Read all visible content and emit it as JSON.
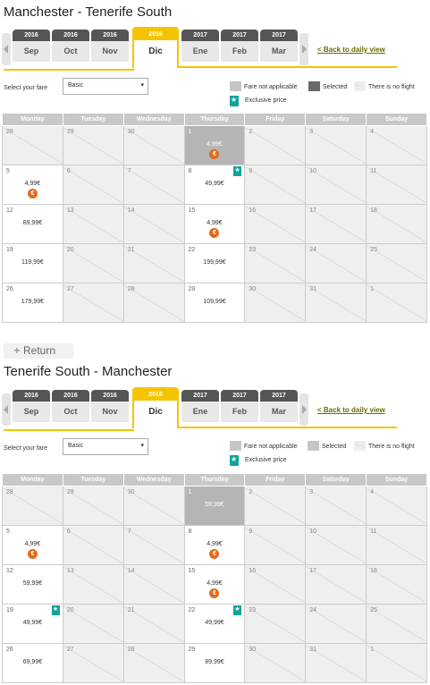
{
  "outbound": {
    "title": "Manchester - Tenerife South",
    "tabs": [
      {
        "year": "2016",
        "month": "Sep",
        "selected": false
      },
      {
        "year": "2016",
        "month": "Oct",
        "selected": false
      },
      {
        "year": "2016",
        "month": "Nov",
        "selected": false
      },
      {
        "year": "2016",
        "month": "Dic",
        "selected": true
      },
      {
        "year": "2017",
        "month": "Ene",
        "selected": false
      },
      {
        "year": "2017",
        "month": "Feb",
        "selected": false
      },
      {
        "year": "2017",
        "month": "Mar",
        "selected": false
      }
    ],
    "back_label": "< Back to daily view",
    "fare_label": "Select your fare",
    "fare_value": "Basic",
    "legend": {
      "not_applicable": "Fare not applicable",
      "selected": "Selected",
      "no_flight": "There is no flight",
      "exclusive": "Exclusive price"
    },
    "weekdays": [
      "Monday",
      "Tuesday",
      "Wednesday",
      "Thursday",
      "Friday",
      "Saturday",
      "Sunday"
    ],
    "weeks": [
      [
        {
          "d": "28",
          "s": "nf"
        },
        {
          "d": "29",
          "s": "nf"
        },
        {
          "d": "30",
          "s": "nf"
        },
        {
          "d": "1",
          "s": "sd",
          "p": "4,99€",
          "coin": true
        },
        {
          "d": "2",
          "s": "nf"
        },
        {
          "d": "3",
          "s": "nf"
        },
        {
          "d": "4",
          "s": "nf"
        }
      ],
      [
        {
          "d": "5",
          "s": "av",
          "p": "4,99€",
          "coin": true
        },
        {
          "d": "6",
          "s": "nf"
        },
        {
          "d": "7",
          "s": "nf"
        },
        {
          "d": "8",
          "s": "av",
          "p": "49,99€",
          "bm": true
        },
        {
          "d": "9",
          "s": "nf"
        },
        {
          "d": "10",
          "s": "nf"
        },
        {
          "d": "11",
          "s": "nf"
        }
      ],
      [
        {
          "d": "12",
          "s": "av",
          "p": "89,99€"
        },
        {
          "d": "13",
          "s": "nf"
        },
        {
          "d": "14",
          "s": "nf"
        },
        {
          "d": "15",
          "s": "av",
          "p": "4,99€",
          "coin": true
        },
        {
          "d": "16",
          "s": "nf"
        },
        {
          "d": "17",
          "s": "nf"
        },
        {
          "d": "18",
          "s": "nf"
        }
      ],
      [
        {
          "d": "19",
          "s": "av",
          "p": "119,99€"
        },
        {
          "d": "20",
          "s": "nf"
        },
        {
          "d": "21",
          "s": "nf"
        },
        {
          "d": "22",
          "s": "av",
          "p": "199,99€"
        },
        {
          "d": "23",
          "s": "nf"
        },
        {
          "d": "24",
          "s": "nf"
        },
        {
          "d": "25",
          "s": "nf"
        }
      ],
      [
        {
          "d": "26",
          "s": "av",
          "p": "179,99€"
        },
        {
          "d": "27",
          "s": "nf"
        },
        {
          "d": "28",
          "s": "nf"
        },
        {
          "d": "29",
          "s": "av",
          "p": "109,99€"
        },
        {
          "d": "30",
          "s": "nf"
        },
        {
          "d": "31",
          "s": "nf"
        },
        {
          "d": "1",
          "s": "nf"
        }
      ]
    ]
  },
  "return_button": {
    "label": "Return"
  },
  "inbound": {
    "title": "Tenerife South - Manchester",
    "tabs": [
      {
        "year": "2016",
        "month": "Sep",
        "selected": false
      },
      {
        "year": "2016",
        "month": "Oct",
        "selected": false
      },
      {
        "year": "2016",
        "month": "Nov",
        "selected": false
      },
      {
        "year": "2016",
        "month": "Dic",
        "selected": true
      },
      {
        "year": "2017",
        "month": "Ene",
        "selected": false
      },
      {
        "year": "2017",
        "month": "Feb",
        "selected": false
      },
      {
        "year": "2017",
        "month": "Mar",
        "selected": false
      }
    ],
    "back_label": "< Back to daily view",
    "fare_label": "Select your fare",
    "fare_value": "Basic",
    "legend": {
      "not_applicable": "Fare not applicable",
      "selected": "Selected",
      "no_flight": "There is no flight",
      "exclusive": "Exclusive price"
    },
    "weekdays": [
      "Monday",
      "Tuesday",
      "Wednesday",
      "Thursday",
      "Friday",
      "Saturday",
      "Sunday"
    ],
    "weeks": [
      [
        {
          "d": "28",
          "s": "nf"
        },
        {
          "d": "29",
          "s": "nf"
        },
        {
          "d": "30",
          "s": "nf"
        },
        {
          "d": "1",
          "s": "sd",
          "p": "59,99€"
        },
        {
          "d": "2",
          "s": "nf"
        },
        {
          "d": "3",
          "s": "nf"
        },
        {
          "d": "4",
          "s": "nf"
        }
      ],
      [
        {
          "d": "5",
          "s": "av",
          "p": "4,99€",
          "coin": true
        },
        {
          "d": "6",
          "s": "nf"
        },
        {
          "d": "7",
          "s": "nf"
        },
        {
          "d": "8",
          "s": "av",
          "p": "4,99€",
          "coin": true
        },
        {
          "d": "9",
          "s": "nf"
        },
        {
          "d": "10",
          "s": "nf"
        },
        {
          "d": "11",
          "s": "nf"
        }
      ],
      [
        {
          "d": "12",
          "s": "av",
          "p": "59,99€"
        },
        {
          "d": "13",
          "s": "nf"
        },
        {
          "d": "14",
          "s": "nf"
        },
        {
          "d": "15",
          "s": "av",
          "p": "4,99€",
          "coin": true
        },
        {
          "d": "16",
          "s": "nf"
        },
        {
          "d": "17",
          "s": "nf"
        },
        {
          "d": "18",
          "s": "nf"
        }
      ],
      [
        {
          "d": "19",
          "s": "av",
          "p": "49,99€",
          "bm": true
        },
        {
          "d": "20",
          "s": "nf"
        },
        {
          "d": "21",
          "s": "nf"
        },
        {
          "d": "22",
          "s": "av",
          "p": "49,99€",
          "bm": true
        },
        {
          "d": "23",
          "s": "nf"
        },
        {
          "d": "24",
          "s": "nf"
        },
        {
          "d": "25",
          "s": "nf"
        }
      ],
      [
        {
          "d": "26",
          "s": "av",
          "p": "69,99€"
        },
        {
          "d": "27",
          "s": "nf"
        },
        {
          "d": "28",
          "s": "nf"
        },
        {
          "d": "29",
          "s": "av",
          "p": "89,99€"
        },
        {
          "d": "30",
          "s": "nf"
        },
        {
          "d": "31",
          "s": "nf"
        },
        {
          "d": "1",
          "s": "nf"
        }
      ]
    ]
  },
  "colors": {
    "accent": "#f5c400",
    "exclusive": "#12a39a",
    "coin": "#e06a1c",
    "header": "#c8c8c8"
  }
}
